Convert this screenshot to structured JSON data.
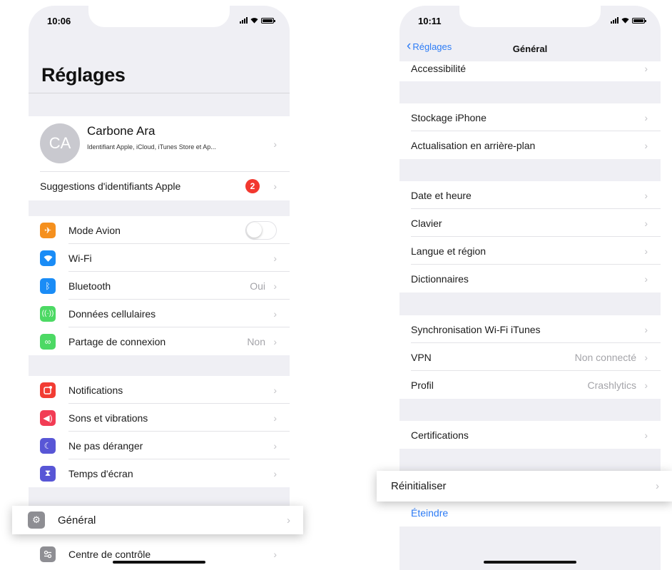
{
  "left": {
    "status_time": "10:06",
    "title": "Réglages",
    "profile": {
      "initials": "CA",
      "name": "Carbone Ara",
      "subtitle": "Identifiant Apple, iCloud, iTunes Store et Ap..."
    },
    "suggestion": {
      "label": "Suggestions d'identifiants Apple",
      "badge": "2"
    },
    "connectivity": [
      {
        "label": "Mode Avion",
        "icon": "airplane-icon",
        "color": "#f5901e",
        "value": ""
      },
      {
        "label": "Wi-Fi",
        "icon": "wifi-icon",
        "color": "#1a8cf6",
        "value": ""
      },
      {
        "label": "Bluetooth",
        "icon": "bluetooth-icon",
        "color": "#1a8cf6",
        "value": "Oui"
      },
      {
        "label": "Données cellulaires",
        "icon": "cellular-icon",
        "color": "#4cd964",
        "value": ""
      },
      {
        "label": "Partage de connexion",
        "icon": "hotspot-icon",
        "color": "#4cd964",
        "value": "Non"
      }
    ],
    "system": [
      {
        "label": "Notifications",
        "icon": "notifications-icon",
        "color": "#f23c33"
      },
      {
        "label": "Sons et vibrations",
        "icon": "sound-icon",
        "color": "#f23c54"
      },
      {
        "label": "Ne pas déranger",
        "icon": "moon-icon",
        "color": "#5856d6"
      },
      {
        "label": "Temps d'écran",
        "icon": "hourglass-icon",
        "color": "#5856d6"
      }
    ],
    "general_highlight": {
      "label": "Général",
      "icon": "gear-icon",
      "color": "#8e8e93"
    },
    "control_center": {
      "label": "Centre de contrôle",
      "icon": "control-center-icon",
      "color": "#8e8e93"
    }
  },
  "right": {
    "status_time": "10:11",
    "back_label": "Réglages",
    "nav_title": "Général",
    "accessibility": "Accessibilité",
    "storage_group": [
      "Stockage iPhone",
      "Actualisation en arrière-plan"
    ],
    "locale_group": [
      "Date et heure",
      "Clavier",
      "Langue et région",
      "Dictionnaires"
    ],
    "network_group": [
      {
        "label": "Synchronisation Wi-Fi iTunes",
        "value": ""
      },
      {
        "label": "VPN",
        "value": "Non connecté"
      },
      {
        "label": "Profil",
        "value": "Crashlytics"
      }
    ],
    "certifications": "Certifications",
    "reset_highlight": "Réinitialiser",
    "shutdown": "Éteindre"
  }
}
